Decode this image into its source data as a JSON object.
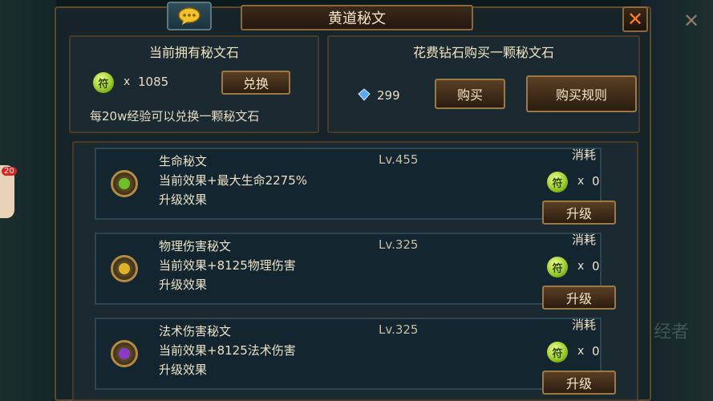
{
  "title": "黄道秘文",
  "owned": {
    "title": "当前拥有秘文石",
    "count_prefix": "x",
    "count": "1085",
    "exchange_button": "兑换",
    "note": "每20w经验可以兑换一颗秘文石"
  },
  "buy": {
    "title": "花费钻石购买一颗秘文石",
    "diamonds": "299",
    "buy_button": "购买",
    "rules_button": "购买规则"
  },
  "side_badge": "20",
  "faint_text": "经者",
  "runes": [
    {
      "name": "生命秘文",
      "level": "Lv.455",
      "current": "当前效果+最大生命2275%",
      "upgrade_label": "升级效果",
      "cost_label": "消耗",
      "cost_prefix": "x",
      "cost": "0",
      "button": "升级",
      "color": "#6fbf2a"
    },
    {
      "name": "物理伤害秘文",
      "level": "Lv.325",
      "current": "当前效果+8125物理伤害",
      "upgrade_label": "升级效果",
      "cost_label": "消耗",
      "cost_prefix": "x",
      "cost": "0",
      "button": "升级",
      "color": "#e0b22a"
    },
    {
      "name": "法术伤害秘文",
      "level": "Lv.325",
      "current": "当前效果+8125法术伤害",
      "upgrade_label": "升级效果",
      "cost_label": "消耗",
      "cost_prefix": "x",
      "cost": "0",
      "button": "升级",
      "color": "#8a3ac4"
    }
  ]
}
